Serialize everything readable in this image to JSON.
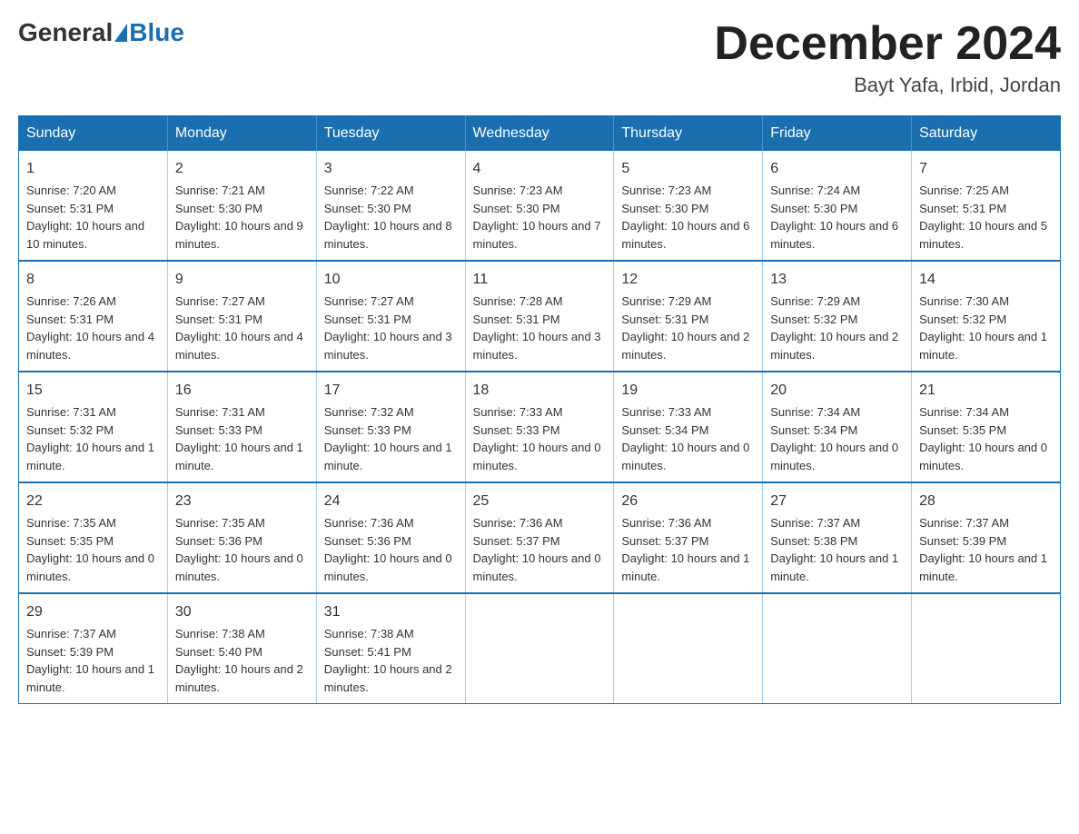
{
  "header": {
    "logo_general": "General",
    "logo_blue": "Blue",
    "month_title": "December 2024",
    "location": "Bayt Yafa, Irbid, Jordan"
  },
  "days_of_week": [
    "Sunday",
    "Monday",
    "Tuesday",
    "Wednesday",
    "Thursday",
    "Friday",
    "Saturday"
  ],
  "weeks": [
    [
      {
        "day": "1",
        "sunrise": "7:20 AM",
        "sunset": "5:31 PM",
        "daylight": "10 hours and 10 minutes."
      },
      {
        "day": "2",
        "sunrise": "7:21 AM",
        "sunset": "5:30 PM",
        "daylight": "10 hours and 9 minutes."
      },
      {
        "day": "3",
        "sunrise": "7:22 AM",
        "sunset": "5:30 PM",
        "daylight": "10 hours and 8 minutes."
      },
      {
        "day": "4",
        "sunrise": "7:23 AM",
        "sunset": "5:30 PM",
        "daylight": "10 hours and 7 minutes."
      },
      {
        "day": "5",
        "sunrise": "7:23 AM",
        "sunset": "5:30 PM",
        "daylight": "10 hours and 6 minutes."
      },
      {
        "day": "6",
        "sunrise": "7:24 AM",
        "sunset": "5:30 PM",
        "daylight": "10 hours and 6 minutes."
      },
      {
        "day": "7",
        "sunrise": "7:25 AM",
        "sunset": "5:31 PM",
        "daylight": "10 hours and 5 minutes."
      }
    ],
    [
      {
        "day": "8",
        "sunrise": "7:26 AM",
        "sunset": "5:31 PM",
        "daylight": "10 hours and 4 minutes."
      },
      {
        "day": "9",
        "sunrise": "7:27 AM",
        "sunset": "5:31 PM",
        "daylight": "10 hours and 4 minutes."
      },
      {
        "day": "10",
        "sunrise": "7:27 AM",
        "sunset": "5:31 PM",
        "daylight": "10 hours and 3 minutes."
      },
      {
        "day": "11",
        "sunrise": "7:28 AM",
        "sunset": "5:31 PM",
        "daylight": "10 hours and 3 minutes."
      },
      {
        "day": "12",
        "sunrise": "7:29 AM",
        "sunset": "5:31 PM",
        "daylight": "10 hours and 2 minutes."
      },
      {
        "day": "13",
        "sunrise": "7:29 AM",
        "sunset": "5:32 PM",
        "daylight": "10 hours and 2 minutes."
      },
      {
        "day": "14",
        "sunrise": "7:30 AM",
        "sunset": "5:32 PM",
        "daylight": "10 hours and 1 minute."
      }
    ],
    [
      {
        "day": "15",
        "sunrise": "7:31 AM",
        "sunset": "5:32 PM",
        "daylight": "10 hours and 1 minute."
      },
      {
        "day": "16",
        "sunrise": "7:31 AM",
        "sunset": "5:33 PM",
        "daylight": "10 hours and 1 minute."
      },
      {
        "day": "17",
        "sunrise": "7:32 AM",
        "sunset": "5:33 PM",
        "daylight": "10 hours and 1 minute."
      },
      {
        "day": "18",
        "sunrise": "7:33 AM",
        "sunset": "5:33 PM",
        "daylight": "10 hours and 0 minutes."
      },
      {
        "day": "19",
        "sunrise": "7:33 AM",
        "sunset": "5:34 PM",
        "daylight": "10 hours and 0 minutes."
      },
      {
        "day": "20",
        "sunrise": "7:34 AM",
        "sunset": "5:34 PM",
        "daylight": "10 hours and 0 minutes."
      },
      {
        "day": "21",
        "sunrise": "7:34 AM",
        "sunset": "5:35 PM",
        "daylight": "10 hours and 0 minutes."
      }
    ],
    [
      {
        "day": "22",
        "sunrise": "7:35 AM",
        "sunset": "5:35 PM",
        "daylight": "10 hours and 0 minutes."
      },
      {
        "day": "23",
        "sunrise": "7:35 AM",
        "sunset": "5:36 PM",
        "daylight": "10 hours and 0 minutes."
      },
      {
        "day": "24",
        "sunrise": "7:36 AM",
        "sunset": "5:36 PM",
        "daylight": "10 hours and 0 minutes."
      },
      {
        "day": "25",
        "sunrise": "7:36 AM",
        "sunset": "5:37 PM",
        "daylight": "10 hours and 0 minutes."
      },
      {
        "day": "26",
        "sunrise": "7:36 AM",
        "sunset": "5:37 PM",
        "daylight": "10 hours and 1 minute."
      },
      {
        "day": "27",
        "sunrise": "7:37 AM",
        "sunset": "5:38 PM",
        "daylight": "10 hours and 1 minute."
      },
      {
        "day": "28",
        "sunrise": "7:37 AM",
        "sunset": "5:39 PM",
        "daylight": "10 hours and 1 minute."
      }
    ],
    [
      {
        "day": "29",
        "sunrise": "7:37 AM",
        "sunset": "5:39 PM",
        "daylight": "10 hours and 1 minute."
      },
      {
        "day": "30",
        "sunrise": "7:38 AM",
        "sunset": "5:40 PM",
        "daylight": "10 hours and 2 minutes."
      },
      {
        "day": "31",
        "sunrise": "7:38 AM",
        "sunset": "5:41 PM",
        "daylight": "10 hours and 2 minutes."
      },
      null,
      null,
      null,
      null
    ]
  ],
  "labels": {
    "sunrise_prefix": "Sunrise: ",
    "sunset_prefix": "Sunset: ",
    "daylight_prefix": "Daylight: "
  }
}
